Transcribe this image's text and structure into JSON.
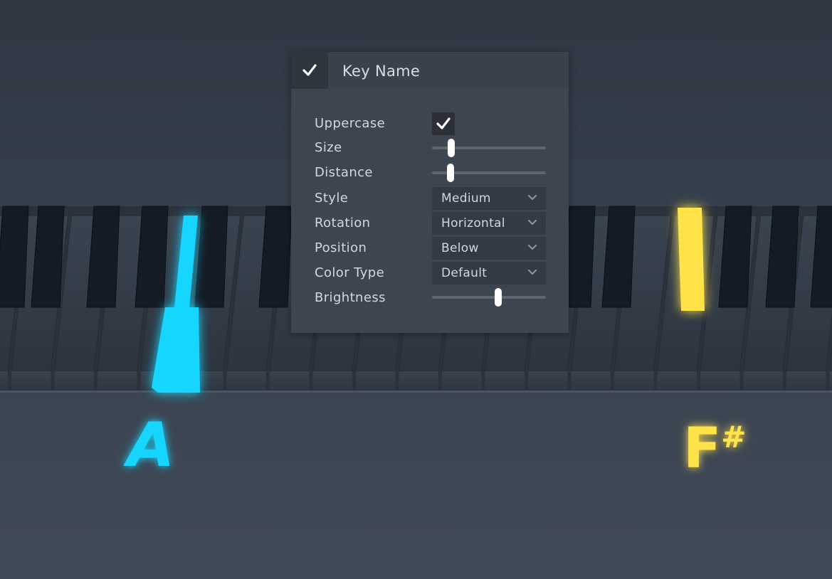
{
  "panel": {
    "title": "Key Name",
    "enabled": true,
    "uppercase": {
      "label": "Uppercase",
      "checked": true
    },
    "size": {
      "label": "Size",
      "value": 0.17
    },
    "distance": {
      "label": "Distance",
      "value": 0.16
    },
    "style": {
      "label": "Style",
      "value": "Medium"
    },
    "rotation": {
      "label": "Rotation",
      "value": "Horizontal"
    },
    "position": {
      "label": "Position",
      "value": "Below"
    },
    "color_type": {
      "label": "Color Type",
      "value": "Default"
    },
    "brightness": {
      "label": "Brightness",
      "value": 0.58
    }
  },
  "keyboard": {
    "labels": [
      {
        "text": "A",
        "color": "#19d6ff"
      },
      {
        "text": "F#",
        "color": "#ffe34a"
      }
    ],
    "highlight_blue": "#19d6ff",
    "highlight_yellow": "#ffe34a"
  }
}
